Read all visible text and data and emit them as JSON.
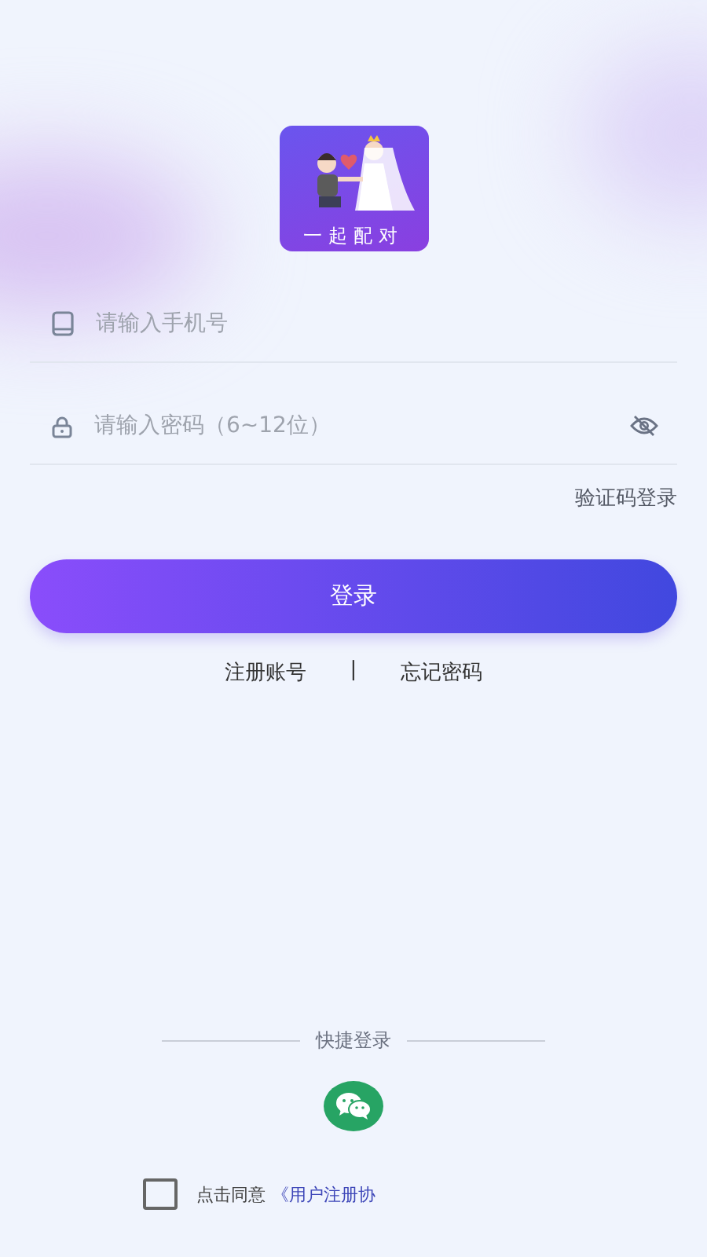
{
  "logo": {
    "caption": "一起配对"
  },
  "phone_field": {
    "placeholder": "请输入手机号"
  },
  "password_field": {
    "placeholder": "请输入密码（6~12位）",
    "password_visible": false
  },
  "code_login_link": "验证码登录",
  "login_button": "登录",
  "links": [
    {
      "label": "注册账号"
    },
    {
      "label": "忘记密码"
    }
  ],
  "link_separator": "|",
  "quick_login": {
    "title": "快捷登录"
  },
  "agreement": {
    "checked": false,
    "text": "点击同意",
    "link": "《用户注册协"
  }
}
